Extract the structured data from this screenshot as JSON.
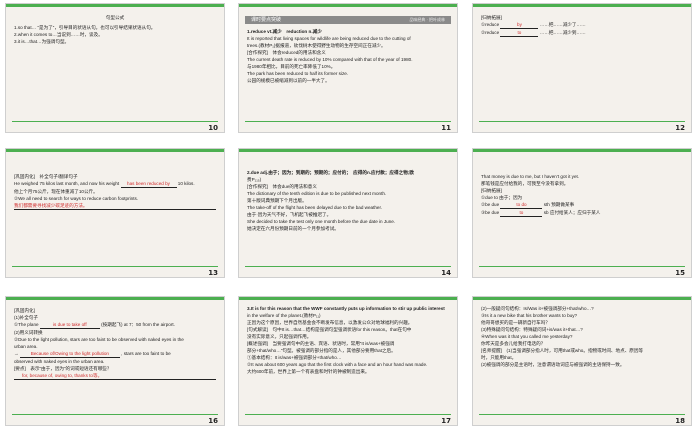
{
  "slides": [
    {
      "num": "10",
      "title": "句型公式",
      "lines": [
        "1.so that… “是为了”，引导目的状语从句。也可以引导结果状语从句。",
        "2.when it comes to…当说到……时，谈及。",
        "3.it is…that…为强调句型。"
      ]
    },
    {
      "num": "11",
      "header": "课时要点突破",
      "header_right": "品味经典 · 把叶成林",
      "lines": [
        "1.reduce vt.减少　reduction n.减少",
        "It is reported that living spaces for wildlife are being reduced due to the cutting of",
        "trees.(教材P₁)据报道，砍伐树木使得野生动物的生存空间正在减少。",
        "[合作探究]　体会reduced的用法和含义",
        "The current death rate is reduced by 10% compared with that of the year of 1980.",
        "与1980年相比，目前的死亡率降低了10%。",
        "The park has been reduced to half its former size.",
        "公园的规模已被缩减到以前的一半大了。"
      ]
    },
    {
      "num": "12",
      "title": "[归纳拓展]",
      "items": [
        {
          "n": "①reduce",
          "blank": "by",
          "tail": "……把……减少了……"
        },
        {
          "n": "②reduce",
          "blank": "to",
          "tail": "……把……减少到……"
        }
      ]
    },
    {
      "num": "13",
      "title": "[巩固内化]　补全句子/翻译句子",
      "l1_pre": "He weighed 75 kilos last month, and now his weight",
      "l1_blank": "has been reduced by",
      "l1_post": "10 kilos.",
      "l2": "他上个月75公斤，现在体重减了10公斤。",
      "l3": "②We all need to search for ways to reduce carbon footprints.",
      "answer": "我们都需要寻找减少碳足迹的方法。"
    },
    {
      "num": "14",
      "lines": [
        "2.due adj.由于；因为；到期的；预期的；应付的；　应得的n.应付款；应得之物;欧",
        "费P₁₁₅)",
        "[合作探究]　体会due的用法和意义",
        "The dictionary of the tenth edition is due to be published next month.",
        "第十版词典预期下个月出版。",
        "The take-off of the flight has been delayed due to the bad weather.",
        "由于·因为天气不好，飞机起飞被推迟了。",
        "She decided to take the test only one month before the due date in June.",
        "她决定在六月份预期日前的一个月参加考试。"
      ]
    },
    {
      "num": "15",
      "lines": [
        "That money is due to me, but I haven’t got it yet.",
        "那笔钱是应付给我的，可我至今没有拿到。"
      ],
      "title": "[归纳拓展]",
      "items": [
        {
          "n": "①due to",
          "tail": "由于；因为"
        },
        {
          "n": "②be due",
          "blank": "to do",
          "tail": "sth 预期做某事"
        },
        {
          "n": "③be due",
          "blank": "to",
          "tail": "sb 应付给某人；应归于某人"
        }
      ]
    },
    {
      "num": "16",
      "title": "[巩固内化]",
      "sub": "(1)补全句子",
      "l1_pre": "①The plane",
      "l1_blank": "is due to take off",
      "l1_post": "(按期起飞) at 7：50 from the airport.",
      "l2": "(2)用义词转换",
      "l3": "②Due to the light pollution, stars are too faint to be observed with naked eyes in the",
      "l4": "urban area.",
      "l5_pre": "→",
      "l5_blank": "Because of/Owing to the light pollution",
      "l5_post": ", stars are too faint to be",
      "l6": "observed with naked eyes in the urban area.",
      "l7": "[要点]　表示“由于，因为”的词或短语还有哪些？",
      "answer": "for, because of, owing to, thanks to等。"
    },
    {
      "num": "17",
      "lines": [
        "3.It is for this reason that the WWF constantly puts up information to stir up public interest",
        "in the welfare of the planet.(教材P₁₁)",
        "正因为这个原因，世界自然基金会不断发布信息，以激发公众对地球福利的兴趣。",
        "[句式解读]　句中It is…that…结构是强调句型强调状语for this reason。that在句中",
        "没有实际意义，只起强调作用。",
        "[概述强调]　当要强调句中的主语、宾语、状语时，常用“It is/was+被强调",
        "部分+that/who…”句型。被强调的部分指的是人，其他部分要用that之后。",
        "①基本结构：It is/was+被强调部分+that/who…",
        "②It was about 600 years ago that the first clock with a face and an hour hand was made.",
        "大约600年前，世界上第一个有表盘和时针的钟被制造出来。"
      ]
    },
    {
      "num": "18",
      "lines": [
        "(2)一般疑问句结构：Is/Was it+被强调部分+that/who…?",
        "③Is it a new bike that his brother wants to buy?",
        "他哥哥想买的是一辆新自行车吗？",
        "(3)特殊疑问句结构：特殊疑问词+is/was it+that…?",
        "④When was it that you called me yesterday?",
        "你昨天是多会儿给我打电话的？",
        "[名师提醒]　(1)当强调部分指人时，可用that或who。指物或时间、地点、原因等",
        "时，只能用that。",
        "(2)被强调的部分是主语时，注意谓语动词应与被强调的主语保持一致。"
      ]
    }
  ]
}
